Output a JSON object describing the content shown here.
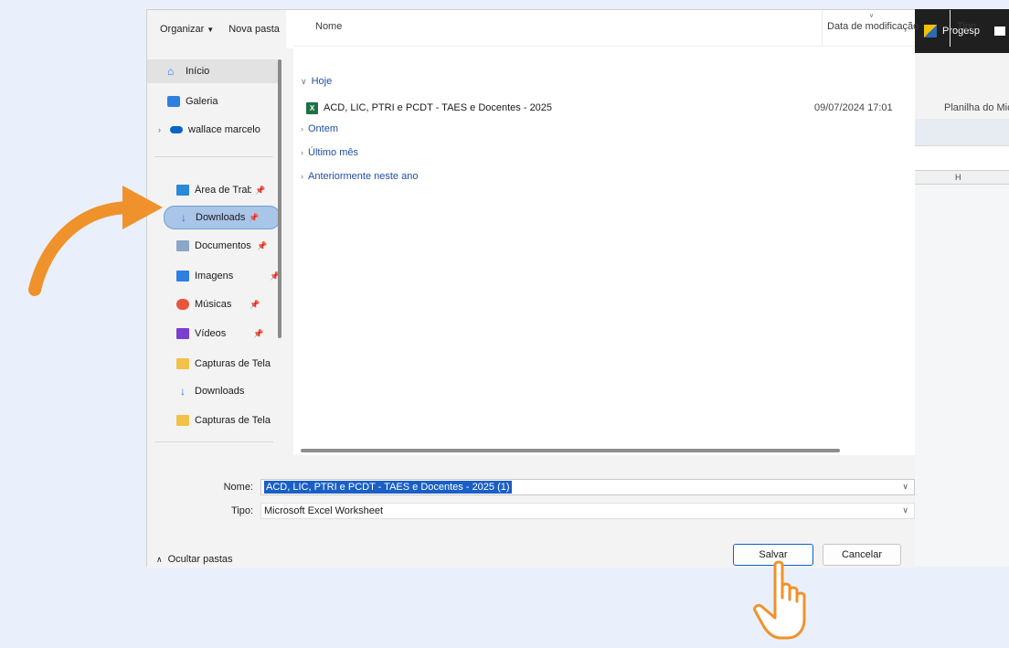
{
  "background_app": {
    "title": "Progesp",
    "column_header": "H"
  },
  "toolbar": {
    "organize_label": "Organizar",
    "new_folder_label": "Nova pasta"
  },
  "nav": {
    "items": [
      {
        "label": "Início"
      },
      {
        "label": "Galeria"
      },
      {
        "label": "wallace marcelo"
      },
      {
        "label": "Área de Trabalho"
      },
      {
        "label": "Downloads"
      },
      {
        "label": "Documentos"
      },
      {
        "label": "Imagens"
      },
      {
        "label": "Músicas"
      },
      {
        "label": "Vídeos"
      },
      {
        "label": "Capturas de Tela"
      },
      {
        "label": "Downloads"
      },
      {
        "label": "Capturas de Tela"
      }
    ]
  },
  "columns": {
    "name": "Nome",
    "modified": "Data de modificação",
    "type": "Tipo"
  },
  "groups": {
    "today": "Hoje",
    "yesterday": "Ontem",
    "last_month": "Último mês",
    "earlier_year": "Anteriormente neste ano"
  },
  "file": {
    "name": "ACD, LIC, PTRI  e PCDT - TAES e Docentes - 2025",
    "modified": "09/07/2024 17:01",
    "type": "Planilha do Micros..."
  },
  "form": {
    "name_label": "Nome:",
    "name_value": "ACD, LIC, PTRI  e PCDT - TAES e Docentes - 2025 (1)",
    "type_label": "Tipo:",
    "type_value": "Microsoft Excel Worksheet",
    "save_label": "Salvar",
    "cancel_label": "Cancelar",
    "hide_folders_label": "Ocultar pastas"
  },
  "colors": {
    "accent": "#0a64c8",
    "selection": "#1a5fc4",
    "annotation": "#f0922b"
  }
}
